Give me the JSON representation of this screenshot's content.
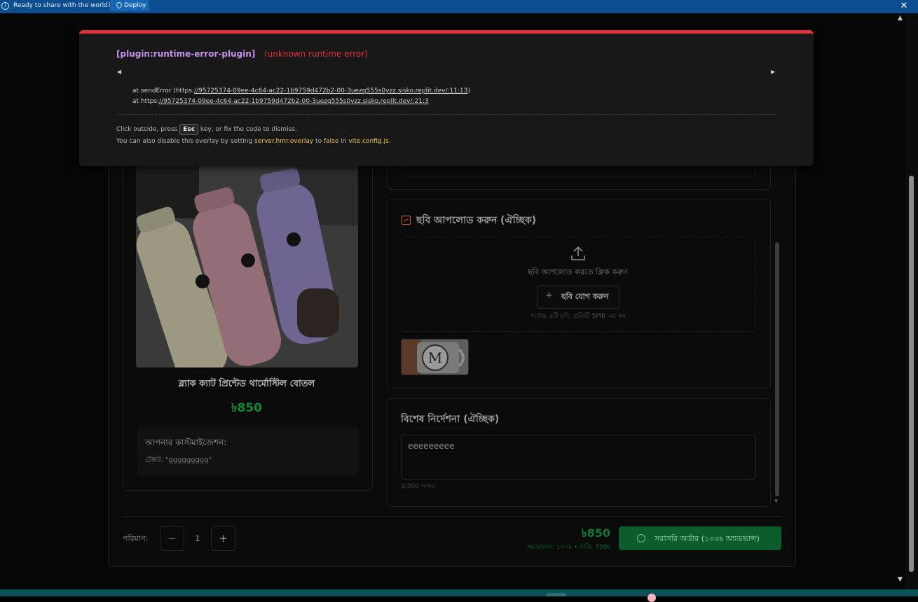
{
  "banner": {
    "message": "Ready to share with the world?",
    "deploy_label": "Deploy"
  },
  "product": {
    "title": "ব্ল্যাক ক্যাট প্রিন্টেড থার্মোস্টিল বোতল",
    "price": "৳850",
    "customization_heading": "আপনার কাস্টমাইজেশন:",
    "customization_text": "টেক্সট: \"ggggggggg\""
  },
  "upload": {
    "heading": "ছবি আপলোড করুন (ঐচ্ছিক)",
    "prompt": "ছবি আপলোড করতে ক্লিক করুন",
    "add_button": "ছবি যোগ করুন",
    "hint": "সর্বোচ্চ ৫টি ছবি, প্রতিটি 5MB এর কম"
  },
  "notes": {
    "heading": "বিশেষ নির্দেশনা (ঐচ্ছিক)",
    "value": "eeeeeeeee",
    "counter": "9/500 অক্ষর"
  },
  "footer": {
    "quantity_label": "পরিমাণ:",
    "quantity_value": "1",
    "minus": "−",
    "plus": "+",
    "total": "৳850",
    "breakdown": "অ্যাডভান্স: ১০০৳ • বাকি: 750৳",
    "order_button": "সরাসরি অর্ডার (১০০৳ অ্যাডভান্স)"
  },
  "error_overlay": {
    "plugin": "[plugin:runtime-error-plugin]",
    "message": "(unknown runtime error)",
    "nav_left": "◀",
    "nav_right": "▶",
    "stack_1_prefix": "at sendError (https:",
    "stack_1_link": "//95725374-09ee-4c64-ac22-1b9759d472b2-00-3uezq555s0yzz.sisko.replit.dev/:11:13",
    "stack_1_suffix": ")",
    "stack_2_prefix": "at https:",
    "stack_2_link": "//95725374-09ee-4c64-ac22-1b9759d472b2-00-3uezq555s0yzz.sisko.replit.dev/:21:3",
    "tip_1_a": "Click outside, press ",
    "tip_1_key": "Esc",
    "tip_1_b": " key, or fix the code to dismiss.",
    "tip_2_a": "You can also disable this overlay by setting ",
    "tip_2_setting": "server.hmr.overlay",
    "tip_2_b": " to ",
    "tip_2_value": "false",
    "tip_2_c": " in ",
    "tip_2_file": "vite.config.js",
    "tip_2_d": "."
  },
  "colors": {
    "banner_bg": "#0b4d91",
    "error_red": "#e0313a",
    "plugin_purple": "#c792ea",
    "accent_green": "#0b5e2c",
    "config_yellow": "#f0c45a"
  }
}
